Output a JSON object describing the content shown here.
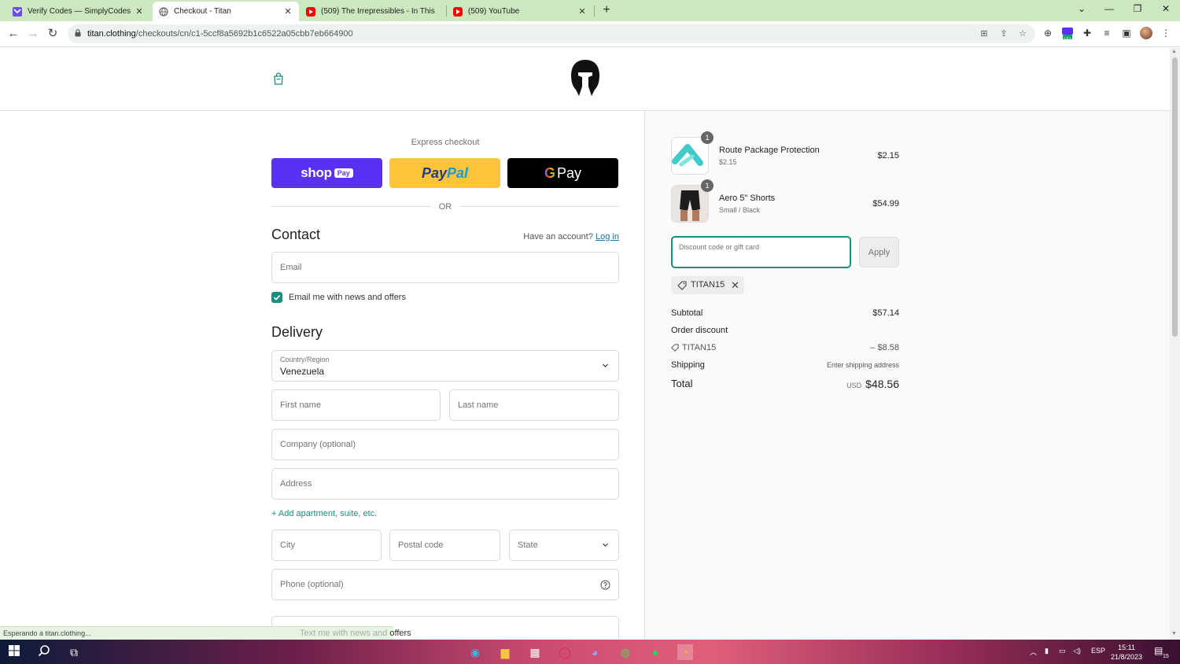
{
  "browser": {
    "tabs": [
      {
        "title": "Verify Codes — SimplyCodes"
      },
      {
        "title": "Checkout - Titan"
      },
      {
        "title": "(509) The Irrepressibles - In This"
      },
      {
        "title": "(509) YouTube"
      }
    ],
    "url_host": "titan.clothing",
    "url_path": "/checkouts/cn/c1-5ccf8a5692b1c6522a05cbb7eb664900",
    "extension_badge": "151",
    "status_text": "Esperando a titan.clothing..."
  },
  "checkout": {
    "express_title": "Express checkout",
    "shop_pay": {
      "word": "shop",
      "pill": "Pay"
    },
    "paypal": {
      "part1": "Pay",
      "part2": "Pal"
    },
    "gpay": {
      "g": "G",
      "word": "Pay"
    },
    "or_text": "OR",
    "contact": {
      "title": "Contact",
      "have_account": "Have an account?",
      "login_link": "Log in",
      "email_placeholder": "Email",
      "newsletter_label": "Email me with news and offers"
    },
    "delivery": {
      "title": "Delivery",
      "country_label": "Country/Region",
      "country_value": "Venezuela",
      "first_name_ph": "First name",
      "last_name_ph": "Last name",
      "company_ph": "Company (optional)",
      "address_ph": "Address",
      "add_apartment": "+ Add apartment, suite, etc.",
      "city_ph": "City",
      "postal_ph": "Postal code",
      "state_ph": "State",
      "phone_ph": "Phone (optional)",
      "text_optin_1": "Text me with news and ",
      "text_optin_2": "offers"
    }
  },
  "summary": {
    "items": [
      {
        "name": "Route Package Protection",
        "variant": "$2.15",
        "price": "$2.15",
        "qty": "1"
      },
      {
        "name": "Aero 5\" Shorts",
        "variant": "Small / Black",
        "price": "$54.99",
        "qty": "1"
      }
    ],
    "discount_placeholder": "Discount code or gift card",
    "apply_label": "Apply",
    "applied_code": "TITAN15",
    "subtotal_label": "Subtotal",
    "subtotal_value": "$57.14",
    "order_discount_label": "Order discount",
    "discount_code": "TITAN15",
    "discount_value": "– $8.58",
    "shipping_label": "Shipping",
    "shipping_value": "Enter shipping address",
    "total_label": "Total",
    "total_currency": "USD",
    "total_value": "$48.56"
  },
  "taskbar": {
    "lang": "ESP",
    "time": "15:11",
    "date": "21/8/2023",
    "notif_count": "15"
  },
  "colors": {
    "accent": "#1b8f7f",
    "shop_pay": "#5a31f4",
    "paypal": "#ffc439",
    "tab_bar": "#cde8c0"
  }
}
